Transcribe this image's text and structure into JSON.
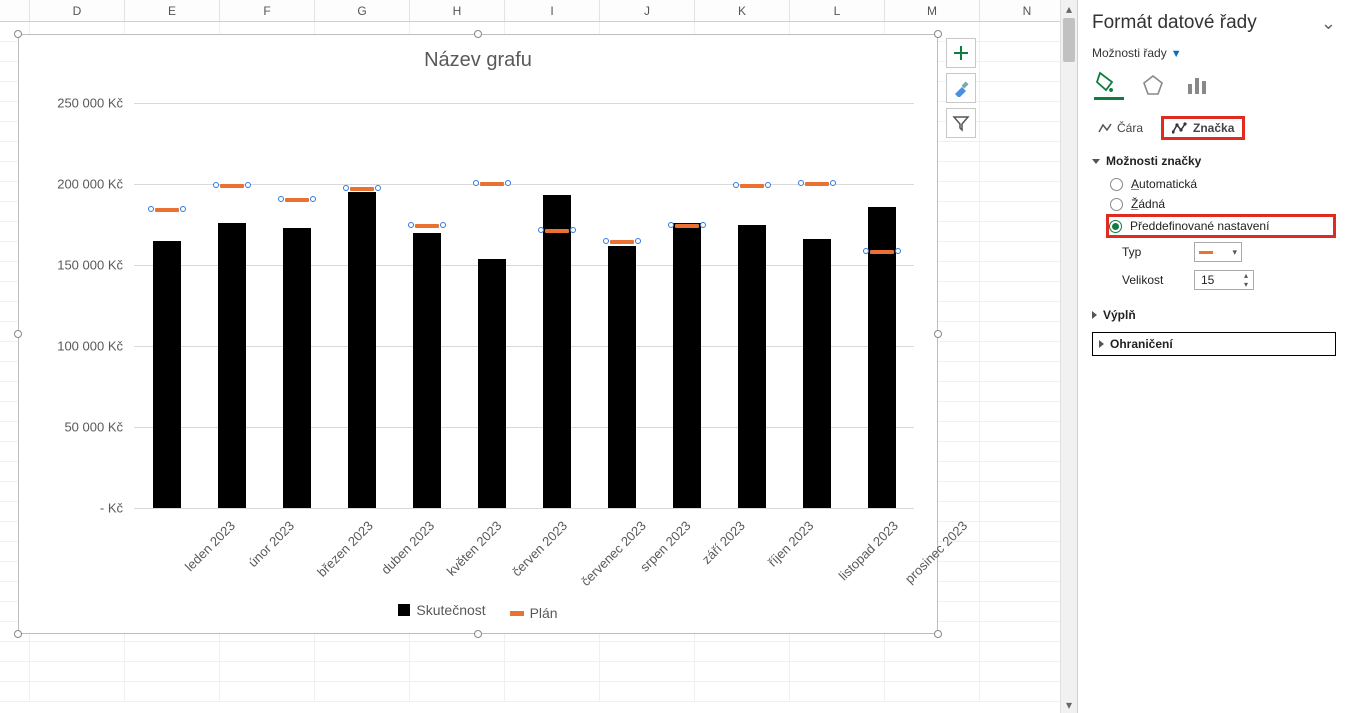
{
  "columns": [
    "D",
    "E",
    "F",
    "G",
    "H",
    "I",
    "J",
    "K",
    "L",
    "M",
    "N"
  ],
  "chart": {
    "title": "Název grafu",
    "legend": {
      "series1": "Skutečnost",
      "series2": "Plán"
    }
  },
  "chart_data": {
    "type": "bar",
    "title": "Název grafu",
    "xlabel": "",
    "ylabel": "",
    "y_unit": "Kč",
    "ylim": [
      0,
      250000
    ],
    "y_ticks": [
      0,
      50000,
      100000,
      150000,
      200000,
      250000
    ],
    "y_tick_labels_text": [
      "-   Kč",
      "50 000  Kč",
      "100 000  Kč",
      "150 000  Kč",
      "200 000  Kč",
      "250 000  Kč"
    ],
    "categories": [
      "leden 2023",
      "únor 2023",
      "březen 2023",
      "duben 2023",
      "květen 2023",
      "červen 2023",
      "červenec 2023",
      "srpen 2023",
      "září 2023",
      "říjen 2023",
      "listopad 2023",
      "prosinec 2023"
    ],
    "series": [
      {
        "name": "Skutečnost",
        "type": "bar",
        "color": "#000000",
        "values": [
          165000,
          176000,
          173000,
          195000,
          170000,
          154000,
          193000,
          162000,
          176000,
          175000,
          166000,
          186000
        ]
      },
      {
        "name": "Plán",
        "type": "marker",
        "color": "#E97132",
        "values": [
          184000,
          199000,
          190000,
          197000,
          174000,
          200000,
          171000,
          164000,
          174000,
          199000,
          200000,
          158000
        ]
      }
    ]
  },
  "tools": {
    "add_element": "chart-elements",
    "styles": "chart-styles",
    "filter": "chart-filters"
  },
  "panel": {
    "title": "Formát datové řady",
    "series_options": "Možnosti řady",
    "tabs": {
      "line": "Čára",
      "marker": "Značka"
    },
    "section_marker_options": "Možnosti značky",
    "radios": {
      "auto": "Automatická",
      "none": "Žádná",
      "preset": "Předdefinované nastavení"
    },
    "type_label": "Typ",
    "size_label": "Velikost",
    "size_value": "15",
    "fill_section": "Výplň",
    "border_section": "Ohraničení"
  }
}
